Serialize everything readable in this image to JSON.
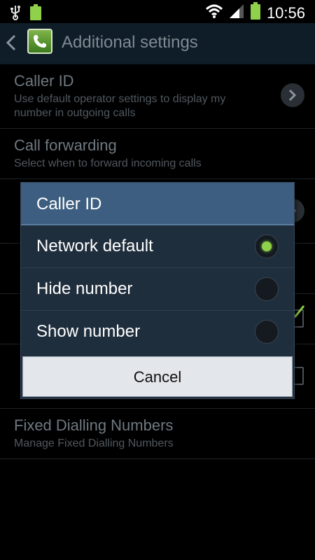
{
  "status_bar": {
    "time": "10:56",
    "icons": [
      "usb-icon",
      "battery-small-icon",
      "wifi-icon",
      "signal-icon",
      "battery-icon"
    ]
  },
  "action_bar": {
    "title": "Additional settings",
    "app_icon": "phone-icon"
  },
  "settings": {
    "caller_id": {
      "title": "Caller ID",
      "subtitle": "Use default operator settings to display my number in outgoing calls"
    },
    "call_forwarding": {
      "title": "Call forwarding",
      "subtitle": "Select when to forward incoming calls"
    },
    "fixed_dialling": {
      "title": "Fixed Dialling Numbers",
      "subtitle": "Manage Fixed Dialling Numbers"
    }
  },
  "dialog": {
    "title": "Caller ID",
    "options": [
      {
        "label": "Network default",
        "selected": true
      },
      {
        "label": "Hide number",
        "selected": false
      },
      {
        "label": "Show number",
        "selected": false
      }
    ],
    "cancel_label": "Cancel",
    "accent_color": "#8fd14a"
  }
}
